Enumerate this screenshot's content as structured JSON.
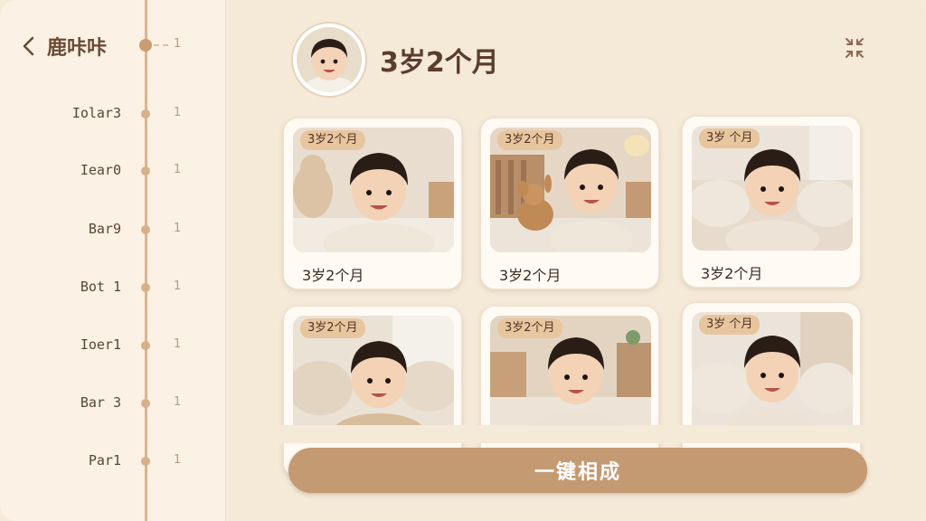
{
  "sidebar": {
    "back_title": "鹿咔咔",
    "items": [
      {
        "label": "",
        "count": "1"
      },
      {
        "label": "Iolar3",
        "count": "1"
      },
      {
        "label": "Iear0",
        "count": "1"
      },
      {
        "label": "Bar9",
        "count": "1"
      },
      {
        "label": "Bot 1",
        "count": "1"
      },
      {
        "label": "Ioer1",
        "count": "1"
      },
      {
        "label": "Bar 3",
        "count": "1"
      },
      {
        "label": "Par1",
        "count": "1"
      }
    ]
  },
  "header": {
    "title": "3岁2个月"
  },
  "photos": [
    {
      "badge": "3岁2个月",
      "caption": "3岁2个月",
      "scene": "teddy-bear"
    },
    {
      "badge": "3岁2个月",
      "caption": "3岁2个月",
      "scene": "fawn-toy"
    },
    {
      "badge": "3岁 个月",
      "caption": "3岁2个月",
      "scene": "sofa"
    },
    {
      "badge": "3岁2个月",
      "caption": "",
      "scene": "sofa-window"
    },
    {
      "badge": "3岁2个月",
      "caption": "",
      "scene": "bedroom"
    },
    {
      "badge": "3岁 个月",
      "caption": "",
      "scene": "bed"
    }
  ],
  "action": {
    "label": "一键相成"
  },
  "icons": {
    "back": "chevron-left-icon",
    "collapse": "collapse-arrows-icon"
  },
  "colors": {
    "background": "#f5e9d8",
    "sidebar": "#fbf1e4",
    "accent": "#c49a72",
    "badge": "#e7c69f",
    "text": "#5a3d2b"
  }
}
